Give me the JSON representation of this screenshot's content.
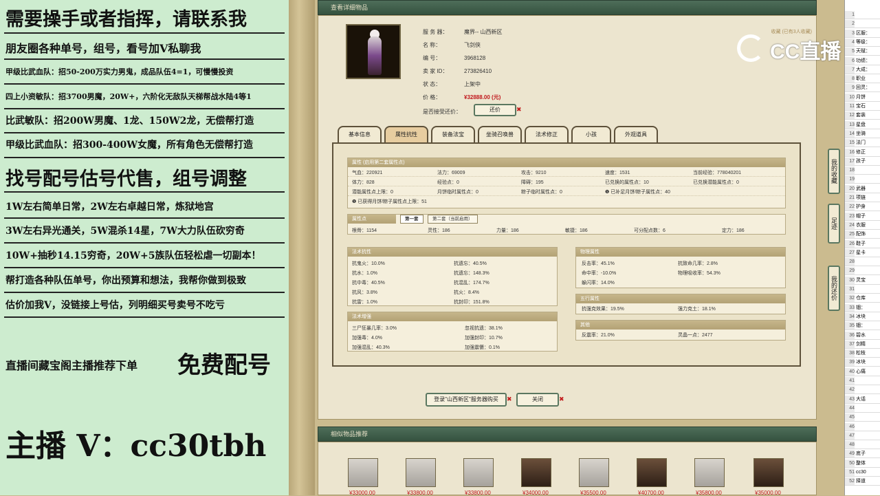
{
  "left_overlay": {
    "lines": [
      "需要操手或者指挥，请联系我",
      "朋友圈各种单号，组号，看号加V私聊我",
      "甲级比武血队：招50-200万实力男鬼，成品队伍4=1，可慢慢投资",
      "四上小资敏队：招3700男魔，20W+，六阶化无敌队天梯帮战水陆4等1",
      "比武敏队：招200W男魔、1龙、150W2龙，无偿帮打造",
      "甲级比武血队：招300-400W女魔，所有角色无偿帮打造",
      "找号配号估号代售，组号调整",
      "1W左右简单日常，2W左右卓越日常，炼狱地宫",
      "3W左右异光通关，5W混杀14星，7W大力队伍砍穷奇",
      "10W+抽秒14.15穷奇，20W+5族队伍轻松虐一切副本！",
      "帮打造各种队伍单号，你出预算和想法，我帮你做到极致",
      "估价加我V，没链接上号估，列明细买号卖号不吃亏",
      "直播间藏宝阁主播推荐下单",
      "免费配号",
      "主播 V：cc30tbh"
    ]
  },
  "detail": {
    "title": "查看详细物品",
    "server_label": "服 务 器：",
    "server": "魔界-- 山西新区",
    "name_label": "名      称：",
    "name": "飞剑侠",
    "id_label": "编      号：",
    "id": "3968128",
    "seller_label": "卖 家 ID：",
    "seller_id": "273826410",
    "status_label": "状      态：",
    "status": "上架中",
    "price_label": "价      格：",
    "price": "¥32888.00 (元)",
    "bargain_label": "是否接受还价：",
    "bargain_button": "还价",
    "favorite": "收藏 (已有3人收藏)"
  },
  "tabs": [
    "基本信息",
    "属性抗性",
    "装备法宝",
    "坐骑召唤兽",
    "法术修正",
    "小孩",
    "外观道具"
  ],
  "active_tab": 1,
  "attr_section": {
    "header": "属性 (启用第二套属性点)",
    "rows": [
      [
        [
          "气血：220921"
        ],
        [
          "法力：69009"
        ],
        [
          "攻击：9210"
        ],
        [
          "速度：1531"
        ],
        [
          "当前经验：778040201"
        ]
      ],
      [
        [
          "体力：828"
        ],
        [
          "经验点：0"
        ],
        [
          "障碍：195"
        ],
        [
          "已兑换的属性点：10"
        ],
        [
          "已兑换潜能属性点：0"
        ]
      ],
      [
        [
          "潜能属性点上限：0"
        ],
        [
          "月饼临时属性点：0"
        ],
        [
          "粽子临时属性点：0"
        ],
        [
          "❶ 已补足月饼/粽子属性点：40"
        ],
        [
          ""
        ]
      ]
    ],
    "note": "❶ 已获得月饼/粽子属性点上限：51"
  },
  "points_section": {
    "header": "属性点",
    "tab1": "第一套",
    "tab2": "第二套（当前启用）",
    "values": [
      "根骨：1154",
      "灵性：186",
      "力量：186",
      "敏捷：186",
      "可分配点数：6",
      "定力：186"
    ]
  },
  "resist_section": {
    "header": "法术抗性",
    "items": [
      [
        "抗鬼火：10.0%",
        "抗遗忘：40.5%"
      ],
      [
        "抗水：1.0%",
        "抗遗忘：148.3%"
      ],
      [
        "抗中毒：40.5%",
        "抗混乱：174.7%"
      ],
      [
        "抗风：3.8%",
        "抗火：8.4%"
      ],
      [
        "抗雷：1.0%",
        "抗封印：151.8%"
      ]
    ]
  },
  "boost_section": {
    "header": "法术增强",
    "items": [
      [
        "三尸狂暴几率：3.0%",
        "忽视抗遗：38.1%"
      ],
      [
        "加强毒：4.0%",
        "加强封印：10.7%"
      ],
      [
        "加强混乱：40.3%",
        "加强震慑：0.1%"
      ]
    ]
  },
  "physical_section": {
    "header": "物理属性",
    "items": [
      [
        "反击率：45.1%",
        "抗致命几率：2.8%"
      ],
      [
        "命中率：-10.0%",
        "物理吸收率：54.3%"
      ],
      [
        "躲闪率：14.0%",
        ""
      ]
    ]
  },
  "element_section": {
    "header": "五行属性",
    "items": [
      [
        "抗强克效果：19.5%",
        "强力克土：18.1%"
      ]
    ]
  },
  "other_section": {
    "header": "其他",
    "items": [
      [
        "反震率：21.0%",
        "灵晶一点：2477"
      ]
    ]
  },
  "actions": {
    "buy": "登录\"山西新区\"服务器购买",
    "close": "关闭"
  },
  "recommend": {
    "title": "相似物品推荐",
    "prices": [
      "¥33000.00",
      "¥33800.00",
      "¥33800.00",
      "¥34000.00",
      "¥35500.00",
      "¥40700.00",
      "¥35800.00",
      "¥35000.00"
    ],
    "portrait_styles": [
      "light",
      "light",
      "light",
      "dark",
      "light",
      "dark",
      "light",
      "dark"
    ]
  },
  "side_buttons": [
    "我的收藏",
    "足迹",
    "我的还价"
  ],
  "logo_text": "CC直播",
  "sheet_rows": [
    [
      "1",
      ""
    ],
    [
      "2",
      ""
    ],
    [
      "3",
      "区服："
    ],
    [
      "4",
      "等级："
    ],
    [
      "5",
      "天赋："
    ],
    [
      "6",
      "功绩："
    ],
    [
      "7",
      "大成："
    ],
    [
      "8",
      "职业"
    ],
    [
      "9",
      "回灵："
    ],
    [
      "10",
      "月饼"
    ],
    [
      "11",
      "宝石"
    ],
    [
      "12",
      "套装"
    ],
    [
      "13",
      "星盘"
    ],
    [
      "14",
      "坐骑"
    ],
    [
      "15",
      "法门"
    ],
    [
      "16",
      "修正"
    ],
    [
      "17",
      "孩子"
    ],
    [
      "18",
      ""
    ],
    [
      "19",
      ""
    ],
    [
      "20",
      "武器"
    ],
    [
      "21",
      "项链"
    ],
    [
      "22",
      "护身"
    ],
    [
      "23",
      "帽子"
    ],
    [
      "24",
      "衣服"
    ],
    [
      "25",
      "配饰"
    ],
    [
      "26",
      "鞋子"
    ],
    [
      "27",
      "星卡"
    ],
    [
      "28",
      ""
    ],
    [
      "29",
      ""
    ],
    [
      "30",
      "灵宝"
    ],
    [
      "31",
      ""
    ],
    [
      "32",
      "仓库"
    ],
    [
      "33",
      "锢："
    ],
    [
      "34",
      "冰块"
    ],
    [
      "35",
      "锢："
    ],
    [
      "36",
      "碧水"
    ],
    [
      "37",
      "剑精"
    ],
    [
      "38",
      "松枝"
    ],
    [
      "39",
      "冰块"
    ],
    [
      "40",
      "心痛"
    ],
    [
      "41",
      ""
    ],
    [
      "42",
      ""
    ],
    [
      "43",
      "大话"
    ],
    [
      "44",
      ""
    ],
    [
      "45",
      ""
    ],
    [
      "46",
      ""
    ],
    [
      "47",
      ""
    ],
    [
      "48",
      ""
    ],
    [
      "49",
      "底子"
    ],
    [
      "50",
      "整体"
    ],
    [
      "51",
      "cc30"
    ],
    [
      "52",
      "择道"
    ]
  ]
}
